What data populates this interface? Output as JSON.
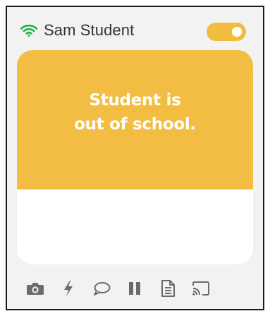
{
  "header": {
    "student_name": "Sam Student",
    "connection_icon": "wifi-icon",
    "toggle_state": "on"
  },
  "status": {
    "message_line1": "Student is",
    "message_line2": "out of school."
  },
  "toolbar": {
    "icons": [
      "camera-icon",
      "lightning-icon",
      "chat-bubble-icon",
      "pause-icon",
      "document-icon",
      "cast-icon"
    ]
  },
  "colors": {
    "accent": "#f2bd42",
    "wifi": "#19b347",
    "icon_gray": "#6b6b6b",
    "panel_bg": "#f2f2f2"
  }
}
